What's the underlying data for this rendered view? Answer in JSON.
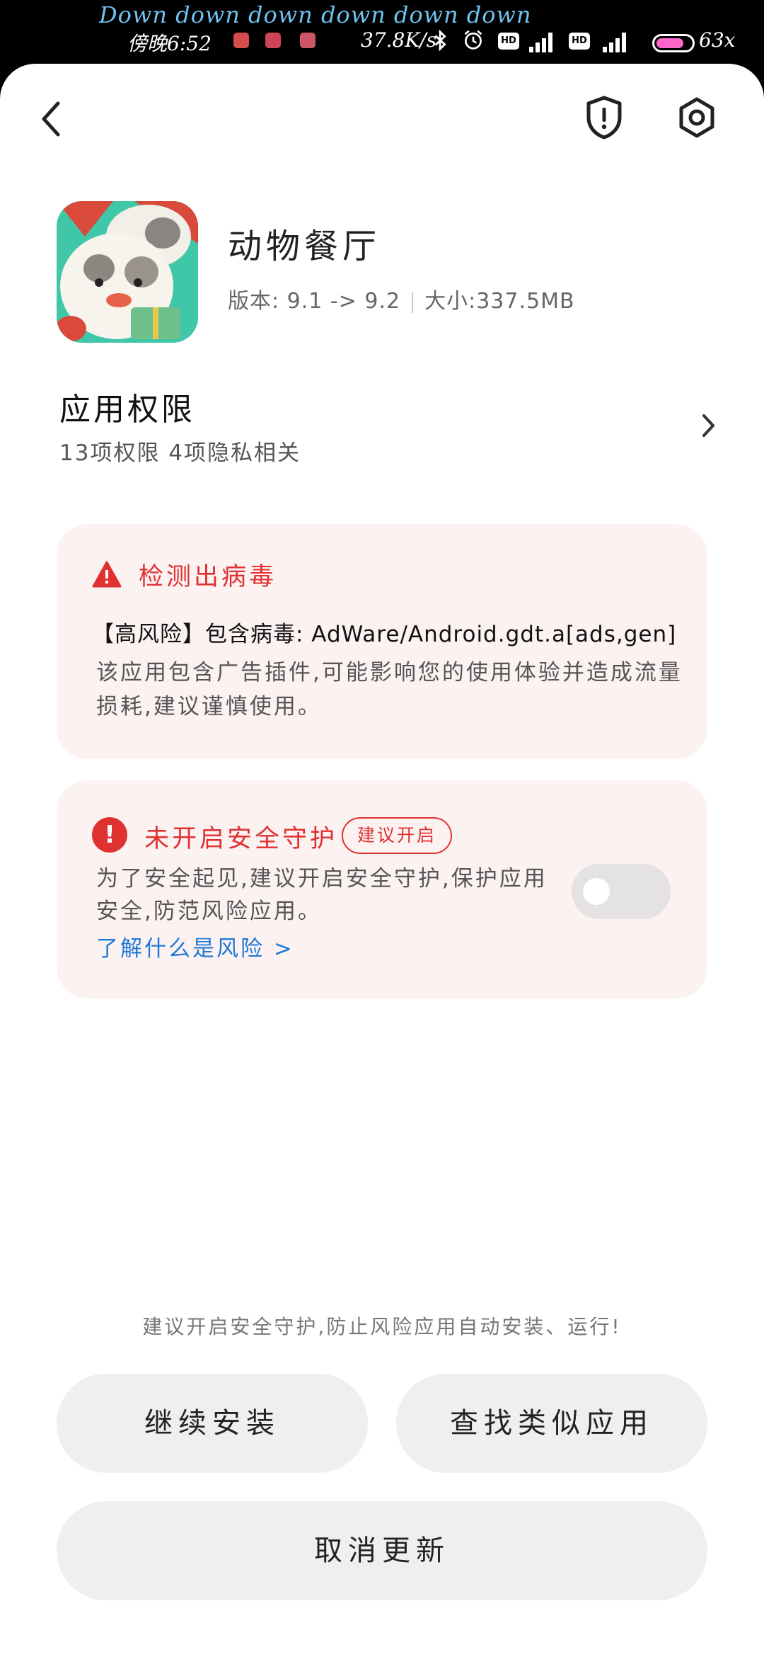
{
  "status_bar": {
    "lyric": "Down down down down down down",
    "time": "傍晚6:52",
    "net_speed": "37.8K/s",
    "hd1": "HD",
    "hd2": "HD",
    "battery": "63x",
    "icons": [
      "notification-icon",
      "bluetooth-icon",
      "alarm-icon",
      "signal-icon",
      "battery-icon"
    ]
  },
  "toolbar": {
    "back_icon": "back-icon",
    "security_icon": "shield-alert-icon",
    "settings_icon": "gear-icon"
  },
  "app": {
    "name": "动物餐厅",
    "version": "版本: 9.1 -> 9.2",
    "size": "大小:337.5MB"
  },
  "permissions": {
    "title": "应用权限",
    "summary": "13项权限 4项隐私相关"
  },
  "virus_card": {
    "title": "检测出病毒",
    "risk": "【高风险】包含病毒: AdWare/Android.gdt.a[ads,gen]",
    "description": "该应用包含广告插件,可能影响您的使用体验并造成流量损耗,建议谨慎使用。"
  },
  "protection_card": {
    "title": "未开启安全守护",
    "badge": "建议开启",
    "description": "为了安全起见,建议开启安全守护,保护应用安全,防范风险应用。",
    "link": "了解什么是风险 >",
    "toggle_on": false
  },
  "footer": {
    "hint": "建议开启安全守护,防止风险应用自动安装、运行!",
    "continue_label": "继续安装",
    "find_similar_label": "查找类似应用",
    "cancel_label": "取消更新"
  },
  "colors": {
    "danger": "#e03131",
    "link": "#1e7ad6",
    "card_bg": "#fdf2f2",
    "button_bg": "#efefef"
  }
}
